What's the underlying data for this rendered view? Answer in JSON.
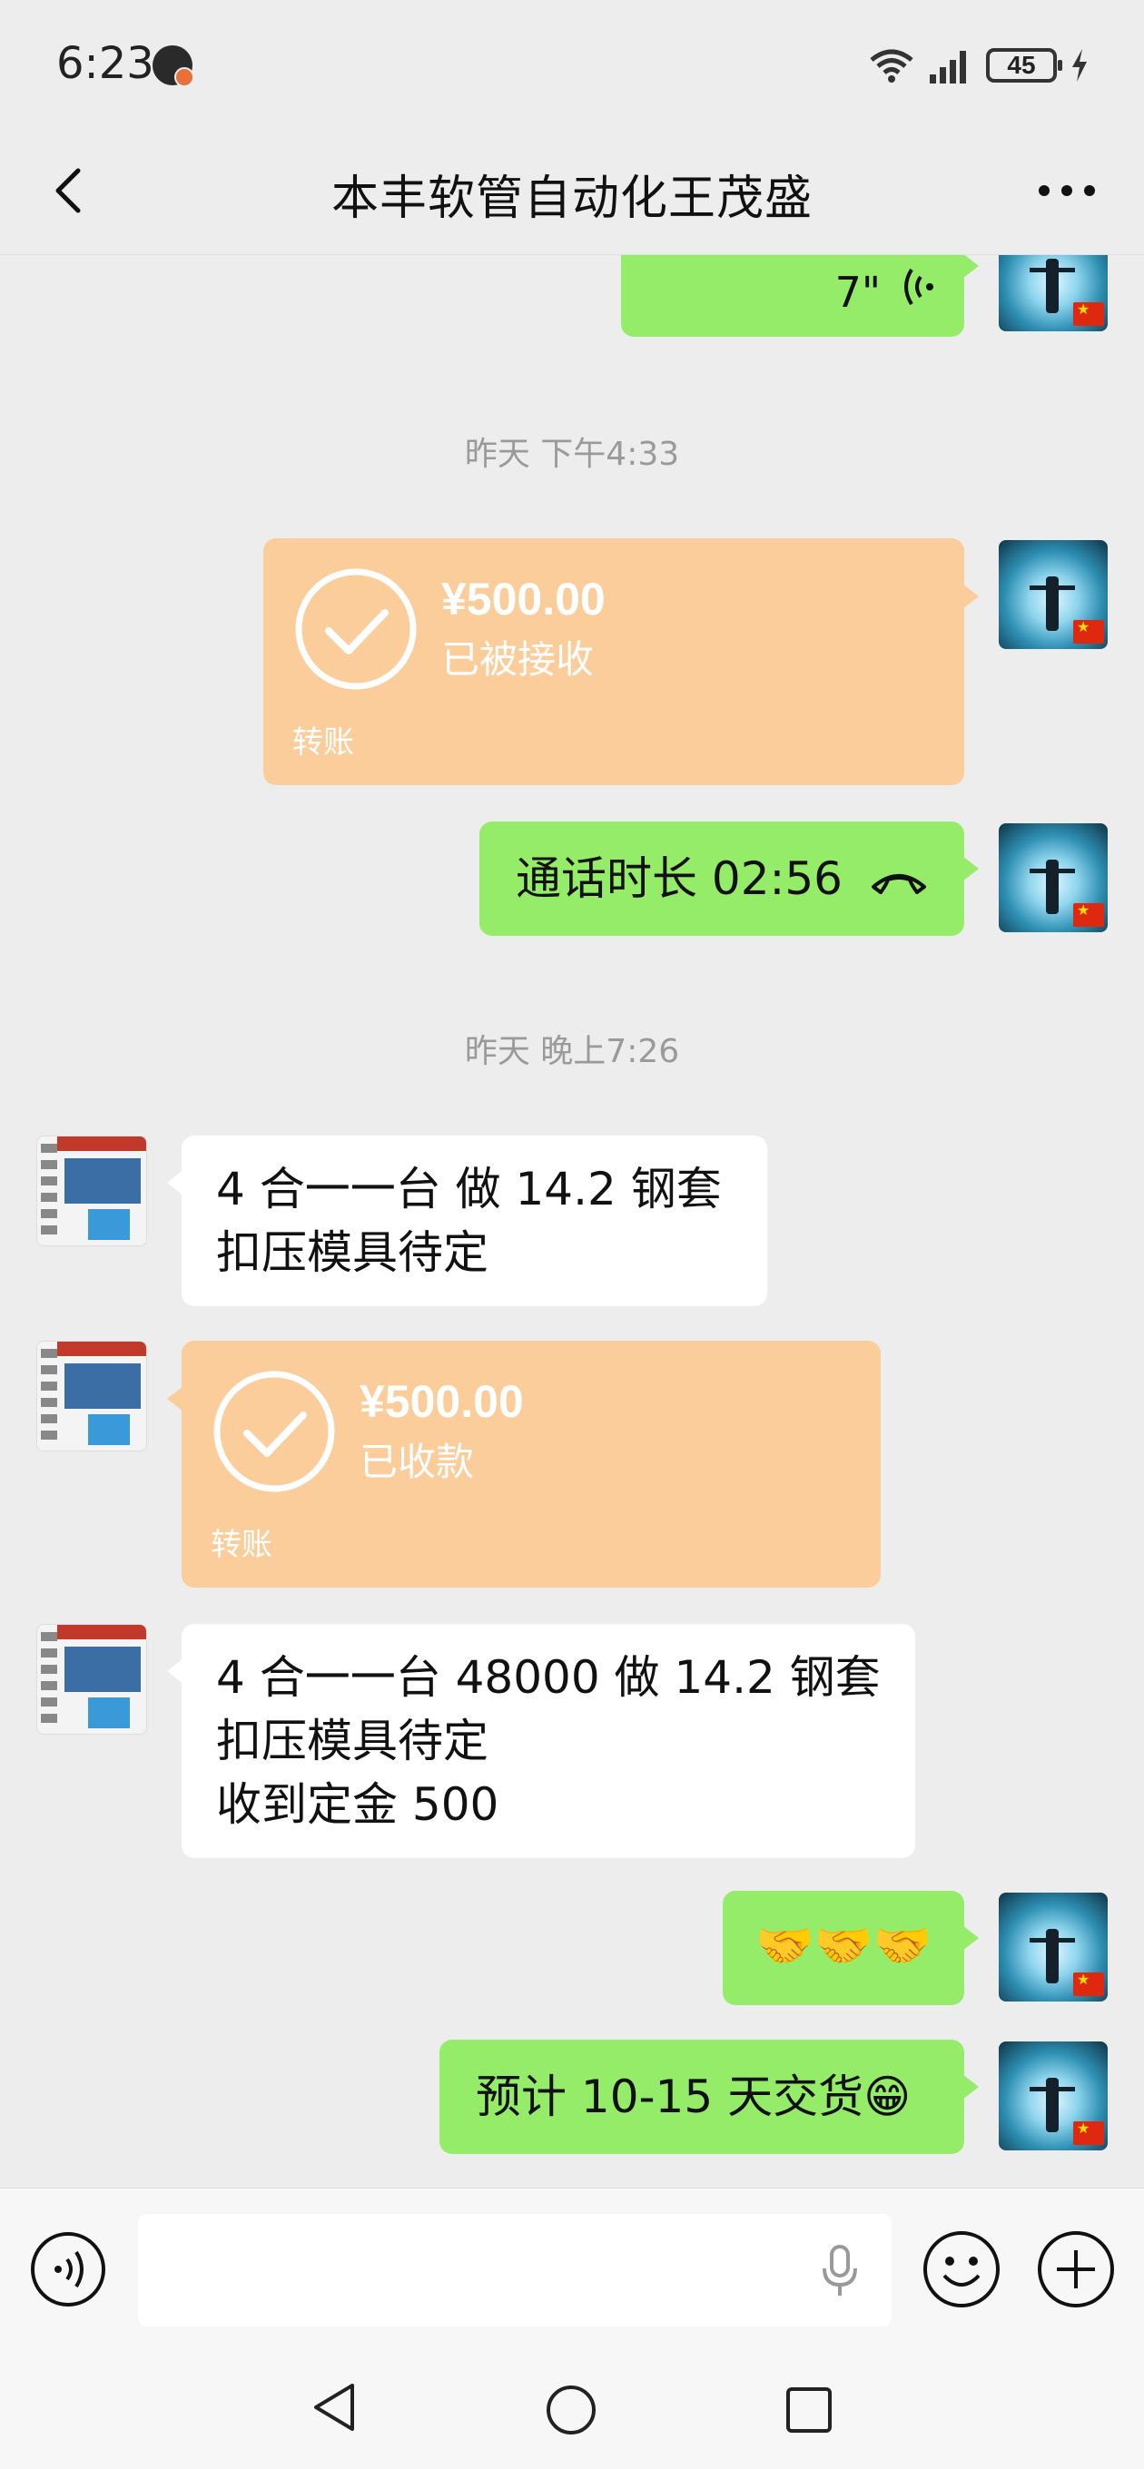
{
  "status_bar": {
    "time": "6:23",
    "battery": "45"
  },
  "nav": {
    "title": "本丰软管自动化王茂盛"
  },
  "messages": {
    "voice_duration": "7\"",
    "ts1": "昨天 下午4:33",
    "transfer1": {
      "amount": "¥500.00",
      "status": "已被接收",
      "label": "转账"
    },
    "call": "通话时长 02:56",
    "ts2": "昨天 晚上7:26",
    "msg1_line1": "4 合一一台  做 14.2 钢套",
    "msg1_line2": "扣压模具待定",
    "transfer2": {
      "amount": "¥500.00",
      "status": "已收款",
      "label": "转账"
    },
    "msg2_line1": "4 合一一台 48000  做 14.2 钢套",
    "msg2_line2": "扣压模具待定",
    "msg2_line3": "收到定金 500",
    "handshakes": "🤝🤝🤝",
    "delivery": "预计 10-15 天交货😁"
  },
  "colors": {
    "green_bubble": "#95ec69",
    "transfer": "#fbcd9b",
    "background": "#ededed"
  }
}
